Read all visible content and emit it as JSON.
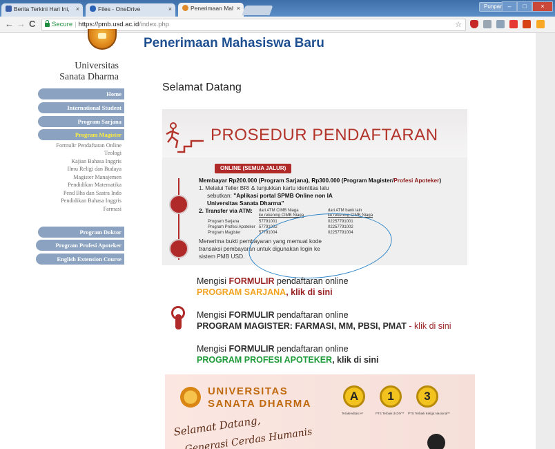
{
  "browser": {
    "tabs": [
      {
        "label": "Berita Terkini Hari Ini, Ka",
        "icon": "news-favicon-icon",
        "active": false
      },
      {
        "label": "Files - OneDrive",
        "icon": "onedrive-cloud-icon",
        "active": false
      },
      {
        "label": "Penerimaan Mahasiswa",
        "icon": "usd-favicon-icon",
        "active": true
      }
    ],
    "close_glyph": "×",
    "window_user": "Punpaningtyas",
    "window_buttons": [
      "–",
      "□",
      "×"
    ],
    "back_glyph": "←",
    "forward_glyph": "→",
    "reload_glyph": "C",
    "secure_label": "Secure",
    "url_sep": "|",
    "url_host": "https://pmb.usd.ac.id",
    "url_path": "/index.php",
    "bookmark_glyph": "☆"
  },
  "site": {
    "university_line1": "Universitas",
    "university_line2": "Sanata Dharma",
    "page_title": "Penerimaan Mahasiswa Baru",
    "welcome": "Selamat Datang"
  },
  "sidebar": {
    "home": "Home",
    "international": "International Student",
    "sarjana": "Program Sarjana",
    "magister": "Program Magister",
    "sub_items": [
      "Formulir Pendaftaran Online",
      "Teologi",
      "Kajian Bahasa Inggris",
      "Ilmu Religi dan Budaya",
      "Magister Manajemen",
      "Pendidikan Matematika",
      "Pend Bhs dan Sastra Indo",
      "Pendidikan Bahasa Inggris",
      "Farmasi"
    ],
    "doktor": "Program Doktor",
    "profesi": "Program Profesi Apoteker",
    "english": "English Extension Course"
  },
  "prosedur": {
    "title": "PROSEDUR PENDAFTARAN",
    "pill": "ONLINE (SEMUA JALUR)",
    "pay_prefix": "Membayar Rp200.000 (Program Sarjana), Rp300.000 (Program Magister/",
    "pay_suffix": "Profesi Apoteker",
    "pay_end": ")",
    "step1_a": "1. Melalui Teller BRI & tunjukkan kartu identitas lalu",
    "step1_b_prefix": "sebutkan: ",
    "step1_b_bold": "\"Aplikasi portal SPMB Online non IA",
    "step1_c": "Universitas Sanata Dharma\"",
    "step2": "2. Transfer via ATM:",
    "atm_col1_h1": "dari ATM CIMB Niaga",
    "atm_col1_h2": "ke rekening CIMB Niaga",
    "atm_col2_h1": "dari ATM bank lain",
    "atm_col2_h2": "ke rekening CIMB Niaga",
    "atm_rows": [
      {
        "prog": "Program Sarjana",
        "a": "57791001",
        "b": "02257791001"
      },
      {
        "prog": "Program Profesi Apoteker",
        "a": "57791002",
        "b": "02257791002"
      },
      {
        "prog": "Program Magister",
        "a": "57791004",
        "b": "02257791004"
      }
    ],
    "receipt_1": "Menerima bukti pembayaran yang memuat kode",
    "receipt_2": "transaksi pembayaran untuk digunakan login ke",
    "receipt_3": "sistem PMB USD."
  },
  "formulir": {
    "prefix": "Mengisi ",
    "bold": "FORMULIR",
    "suffix": " pendaftaran online",
    "sarjana_prog": "PROGRAM SARJANA",
    "sarjana_link": ", klik di sini",
    "magister_prog": "PROGRAM MAGISTER: FARMASI, MM, PBSI, PMAT",
    "magister_link": " - klik di sini",
    "profesi_prog": "PROGRAM PROFESI APOTEKER",
    "profesi_link": ", klik di sini"
  },
  "bottom_banner": {
    "name1": "UNIVERSITAS",
    "name2": "SANATA DHARMA",
    "medals": [
      {
        "glyph": "A",
        "caption": "Terakreditasi A*"
      },
      {
        "glyph": "1",
        "caption": "PTS Terbaik di DIY**"
      },
      {
        "glyph": "3",
        "caption": "PTS Terbaik Ketiga Nasional**"
      }
    ],
    "script1": "Selamat Datang,",
    "script2": "Generasi Cerdas Humanis"
  }
}
